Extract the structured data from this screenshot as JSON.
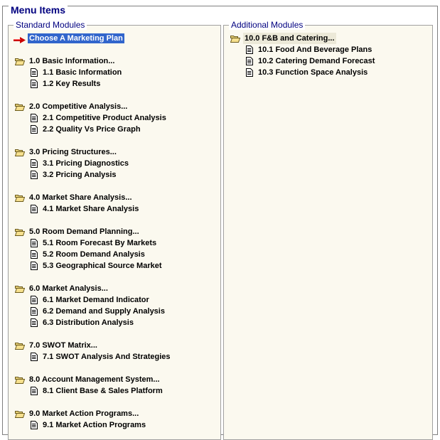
{
  "title": "Menu Items",
  "standard": {
    "legend": "Standard Modules",
    "choose_label": "Choose A Marketing Plan",
    "groups": [
      {
        "title": "1.0 Basic Information...",
        "items": [
          "1.1 Basic Information",
          "1.2 Key Results"
        ]
      },
      {
        "title": "2.0 Competitive Analysis...",
        "items": [
          "2.1 Competitive Product Analysis",
          "2.2 Quality Vs Price Graph"
        ]
      },
      {
        "title": "3.0 Pricing Structures...",
        "items": [
          "3.1 Pricing Diagnostics",
          "3.2 Pricing Analysis"
        ]
      },
      {
        "title": "4.0 Market Share Analysis...",
        "items": [
          "4.1 Market Share Analysis"
        ]
      },
      {
        "title": "5.0 Room Demand Planning...",
        "items": [
          "5.1 Room Forecast By Markets",
          "5.2 Room Demand Analysis",
          "5.3 Geographical Source Market"
        ]
      },
      {
        "title": "6.0 Market Analysis...",
        "items": [
          "6.1 Market Demand Indicator",
          "6.2 Demand and Supply Analysis",
          "6.3 Distribution Analysis"
        ]
      },
      {
        "title": "7.0 SWOT Matrix...",
        "items": [
          "7.1 SWOT Analysis And Strategies"
        ]
      },
      {
        "title": "8.0 Account Management System...",
        "items": [
          "8.1 Client Base & Sales Platform"
        ]
      },
      {
        "title": "9.0 Market Action Programs...",
        "items": [
          "9.1 Market Action Programs"
        ]
      }
    ]
  },
  "additional": {
    "legend": "Additional Modules",
    "groups": [
      {
        "title": "10.0 F&B and Catering...",
        "items": [
          "10.1 Food And Beverage Plans",
          "10.2 Catering Demand Forecast",
          "10.3 Function Space Analysis"
        ]
      }
    ]
  },
  "icons": {
    "folder": "open-folder-icon",
    "document": "document-icon",
    "pointer": "red-arrow-icon"
  },
  "colors": {
    "legend": "#000080",
    "panel_bg": "#fbf9ef",
    "selection": "#3165cc",
    "arrow": "#cc0000"
  }
}
